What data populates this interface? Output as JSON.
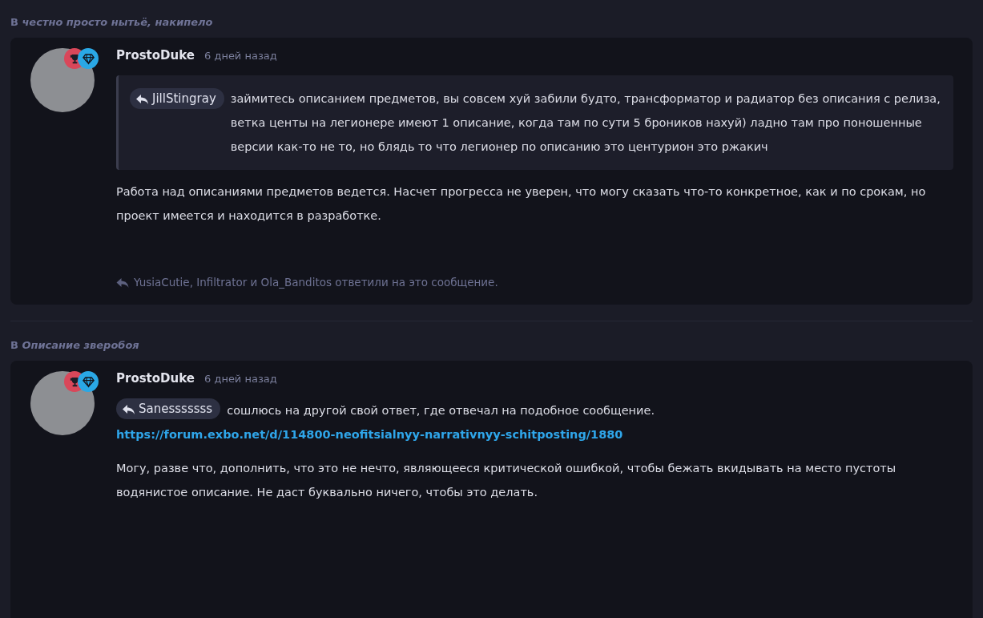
{
  "posts": [
    {
      "discussion": "В *честно просто нытьё, накипело*",
      "author": "ProstoDuke",
      "time": "6 дней назад",
      "badges": [
        {
          "kind": "trophy",
          "color": "#d9475a"
        },
        {
          "kind": "gem",
          "color": "#2aa8e6"
        }
      ],
      "blocks": [
        {
          "kind": "quote",
          "mention": "JillStingray",
          "text": "займитесь описанием предметов, вы совсем хуй забили будто, трансформатор и радиатор без описания с релиза, ветка центы на легионере имеют 1 описание, когда там по сути 5 броников нахуй) ладно там про поношенные версии как-то не то, но блядь то что легионер по описанию это центурион это ржакич"
        },
        {
          "kind": "paragraph",
          "text": "Работа над описаниями предметов ведется. Насчет прогресса не уверен, что могу сказать что-то конкретное, как и по срокам, но проект имеется и находится в разработке."
        }
      ],
      "replies": "YusiaCutie, Infiltrator и Ola_Banditos ответили на это сообщение."
    },
    {
      "discussion": "В *Описание зверобоя*",
      "author": "ProstoDuke",
      "time": "6 дней назад",
      "badges": [
        {
          "kind": "trophy",
          "color": "#d9475a"
        },
        {
          "kind": "gem",
          "color": "#2aa8e6"
        }
      ],
      "blocks": [
        {
          "kind": "reply",
          "mention": "Sanesssssss",
          "text": "сошлюсь на другой свой ответ, где отвечал на подобное сообщение.",
          "link": "https://forum.exbo.net/d/114800-neofitsialnyy-narrativnyy-schitposting/1880"
        },
        {
          "kind": "paragraph",
          "text": "Могу, разве что, дополнить, что это не нечто, являющееся критической ошибкой, чтобы бежать вкидывать на место пустоты водянистое описание. Не даст буквально ничего, чтобы это делать."
        }
      ]
    }
  ]
}
